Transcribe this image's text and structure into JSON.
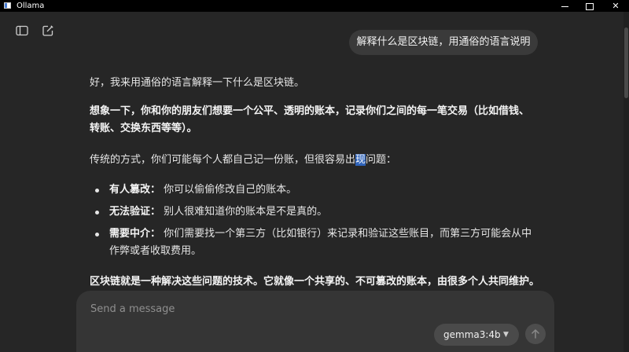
{
  "window": {
    "title": "Ollama",
    "controls": {
      "minimize": "minimize",
      "maximize": "maximize",
      "close": "✕"
    }
  },
  "toolbar": {
    "sidebar_icon": "sidebar-toggle-icon",
    "new_chat_icon": "new-chat-icon"
  },
  "chat": {
    "user_message": "解释什么是区块链，用通俗的语言说明",
    "assistant": {
      "intro": "好，我来用通俗的语言解释一下什么是区块链。",
      "emphasis": "想象一下，你和你的朋友们想要一个公平、透明的账本，记录你们之间的每一笔交易（比如借钱、转账、交换东西等等）。",
      "traditional_before": "传统的方式，你们可能每个人都自己记一份账，但很容易出",
      "traditional_highlight": "现",
      "traditional_after": "问题：",
      "issues": [
        {
          "title": "有人篡改：",
          "text": "你可以偷偷修改自己的账本。"
        },
        {
          "title": "无法验证：",
          "text": "别人很难知道你的账本是不是真的。"
        },
        {
          "title": "需要中介：",
          "text": "你们需要找一个第三方（比如银行）来记录和验证这些账目，而第三方可能会从中作弊或者收取费用。"
        }
      ],
      "conclusion": "区块链就是一种解决这些问题的技术。它就像一个共享的、不可篡改的账本，由很多个人共同维护。"
    }
  },
  "composer": {
    "placeholder": "Send a message",
    "value": "",
    "model": "gemma3:4b",
    "send_icon": "arrow-up-icon"
  },
  "colors": {
    "background": "#262626",
    "user_bubble": "#3a3a3a",
    "composer": "#353535",
    "selection": "#2f63b9"
  }
}
